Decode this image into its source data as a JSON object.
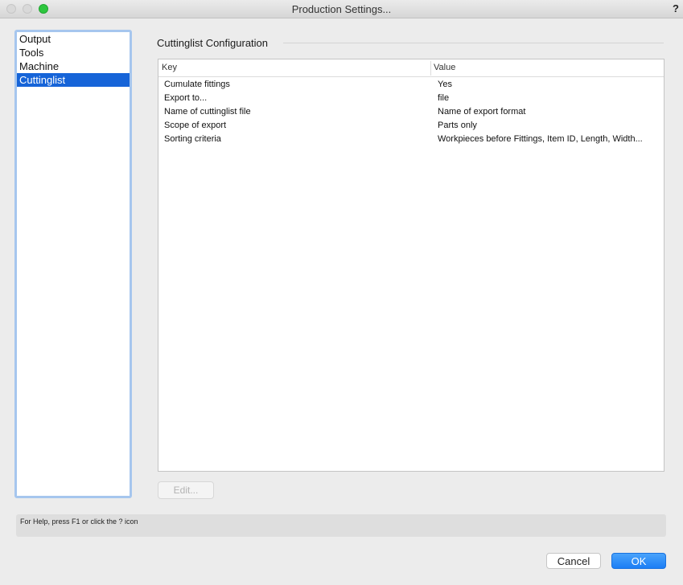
{
  "window": {
    "title": "Production Settings...",
    "help_symbol": "?"
  },
  "nav": {
    "items": [
      {
        "label": "Output",
        "selected": false
      },
      {
        "label": "Tools",
        "selected": false
      },
      {
        "label": "Machine",
        "selected": false
      },
      {
        "label": "Cuttinglist",
        "selected": true
      }
    ]
  },
  "section": {
    "title": "Cuttinglist Configuration"
  },
  "table": {
    "headers": {
      "key": "Key",
      "value": "Value"
    },
    "rows": [
      {
        "key": "Cumulate fittings",
        "value": "Yes"
      },
      {
        "key": "Export to...",
        "value": "file"
      },
      {
        "key": "Name of cuttinglist file",
        "value": "Name of export format"
      },
      {
        "key": "Scope of export",
        "value": "Parts only"
      },
      {
        "key": "Sorting criteria",
        "value": "Workpieces before Fittings, Item ID, Length, Width..."
      }
    ]
  },
  "edit_button": {
    "label": "Edit...",
    "enabled": false
  },
  "status": {
    "text": "For Help, press F1 or click the ? icon"
  },
  "buttons": {
    "cancel": "Cancel",
    "ok": "OK"
  },
  "colors": {
    "selection": "#1664d8",
    "ok_button": "#1b7ef5",
    "list_focus_ring": "#a6c6ee"
  }
}
